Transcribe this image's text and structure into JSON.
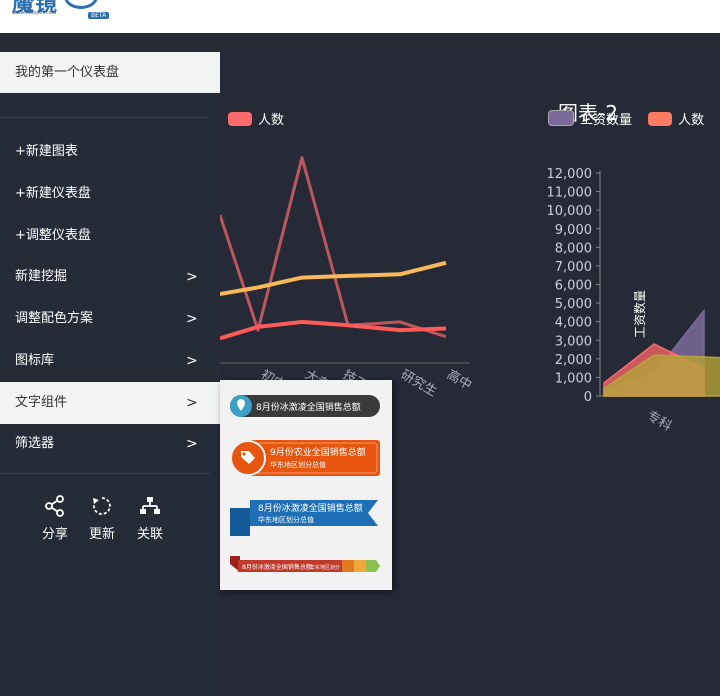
{
  "logo": {
    "text": "魔镜",
    "url": "www.moojnn.com",
    "beta": "BETA"
  },
  "sidebar": {
    "dashboard_title": "我的第一个仪表盘",
    "items": [
      {
        "label": "+新建图表",
        "chevron": ""
      },
      {
        "label": "+新建仪表盘",
        "chevron": ""
      },
      {
        "label": "+调整仪表盘",
        "chevron": ""
      },
      {
        "label": "新建挖掘",
        "chevron": ">"
      },
      {
        "label": "调整配色方案",
        "chevron": ">"
      },
      {
        "label": "图标库",
        "chevron": ">"
      },
      {
        "label": "文字组件",
        "chevron": ">"
      },
      {
        "label": "筛选器",
        "chevron": ">"
      }
    ],
    "actions": [
      {
        "label": "分享",
        "icon": "share-icon"
      },
      {
        "label": "更新",
        "icon": "refresh-icon"
      },
      {
        "label": "关联",
        "icon": "hierarchy-icon"
      }
    ]
  },
  "text_widgets": [
    {
      "title": "8月份冰激凌全国销售总额",
      "subtitle": ""
    },
    {
      "title": "9月份农业全国销售总额",
      "subtitle": "华东地区划分总值"
    },
    {
      "title": "8月份冰激凌全国销售总额",
      "subtitle": "华东地区划分总值"
    },
    {
      "title": "8月份冰激凌全国销售总额",
      "subtitle": "华东地区划分"
    }
  ],
  "colors": {
    "bg": "#252a36",
    "sidebar": "#262b38",
    "active": "#f2f3f3",
    "accent_orange": "#e8550f",
    "accent_blue": "#1f6fb6"
  },
  "chart_data": [
    {
      "type": "line",
      "title": "",
      "categories": [
        "初中",
        "大专",
        "技工",
        "研究生",
        "高中"
      ],
      "series": [
        {
          "name": "人数",
          "color": "#ff6b6b",
          "values": [
            9000,
            2000,
            12500,
            2300,
            2500,
            1600
          ]
        },
        {
          "name": "",
          "color": "#f9b85a",
          "values": [
            4200,
            4600,
            5200,
            5300,
            5400,
            6100
          ]
        },
        {
          "name": "",
          "color": "#ff5a5a",
          "values": [
            1500,
            2200,
            2500,
            2300,
            2000,
            2100
          ]
        }
      ],
      "legend": [
        "人数"
      ]
    },
    {
      "type": "area",
      "title": "图表-2",
      "ylabel": "工资数量",
      "categories": [
        "专科"
      ],
      "yticks": [
        "12,000",
        "11,000",
        "10,000",
        "9,000",
        "8,000",
        "7,000",
        "6,000",
        "5,000",
        "4,000",
        "3,000",
        "2,000",
        "1,000",
        "0"
      ],
      "ylim": [
        0,
        12000
      ],
      "series": [
        {
          "name": "工资数量",
          "color": "#7a6a9a",
          "values": [
            300,
            1200,
            4600
          ]
        },
        {
          "name": "人数",
          "color": "#ff6b6b",
          "values": [
            700,
            2800,
            1500
          ]
        }
      ],
      "legend": [
        "工资数量",
        "人数"
      ]
    }
  ]
}
